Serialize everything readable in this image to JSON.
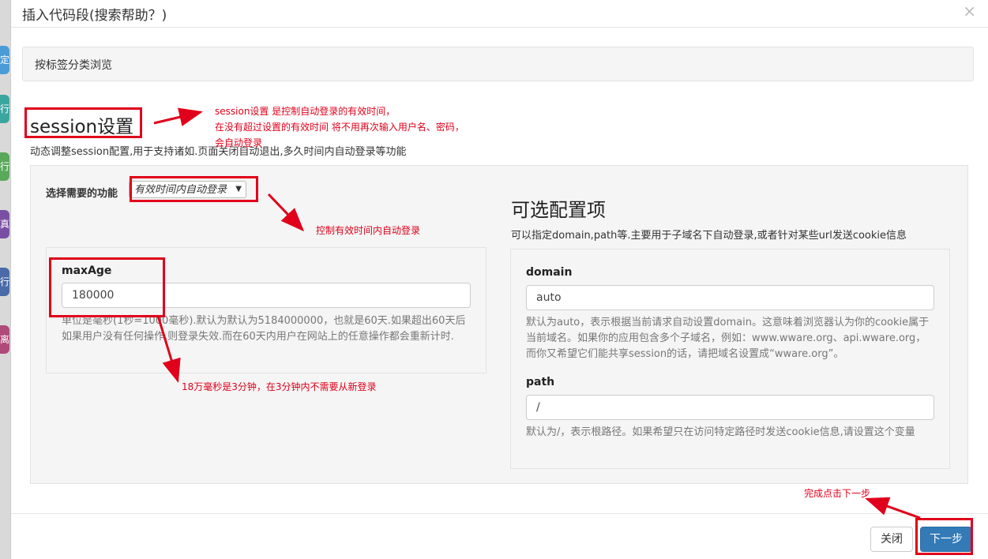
{
  "background": {
    "tabs": [
      {
        "text": "定",
        "color": "#4a9bd6"
      },
      {
        "text": "行",
        "color": "#3aa6a0"
      },
      {
        "text": "行",
        "color": "#5aa85a"
      },
      {
        "text": "真",
        "color": "#7a4fa3"
      },
      {
        "text": "行",
        "color": "#4a6ba8"
      },
      {
        "text": "离",
        "color": "#b04a7a"
      }
    ]
  },
  "modal": {
    "title": "插入代码段(搜索帮助？)",
    "close_glyph": "×"
  },
  "tag_bar": {
    "label": "按标签分类浏览"
  },
  "session": {
    "title": "session设置",
    "description": "动态调整session配置,用于支持诸如.页面关闭自动退出,多久时间内自动登录等功能"
  },
  "function_select": {
    "label": "选择需要的功能",
    "value": "有效时间内自动登录",
    "caret": "▼"
  },
  "maxage": {
    "label": "maxAge",
    "value": "180000",
    "help": "单位是毫秒(1秒=1000毫秒).默认为默认为5184000000，也就是60天.如果超出60天后如果用户没有任何操作,则登录失效.而在60天内用户在网站上的任意操作都会重新计时."
  },
  "optional": {
    "title": "可选配置项",
    "description": "可以指定domain,path等.主要用于子域名下自动登录,或者针对某些url发送cookie信息",
    "domain": {
      "label": "domain",
      "value": "auto",
      "help": "默认为auto，表示根据当前请求自动设置domain。这意味着浏览器认为你的cookie属于当前域名。如果你的应用包含多个子域名，例如：www.wware.org、api.wware.org，而你又希望它们能共享session的话，请把域名设置成“wware.org”。"
    },
    "path": {
      "label": "path",
      "value": "/",
      "help": "默认为/，表示根路径。如果希望只在访问特定路径时发送cookie信息,请设置这个变量"
    }
  },
  "annotations": {
    "session_note": [
      "session设置 是控制自动登录的有效时间，",
      "在没有超过设置的有效时间 将不用再次输入用户名、密码，",
      "会自动登录"
    ],
    "select_note": "控制有效时间内自动登录",
    "maxage_note": "18万毫秒是3分钟，在3分钟内不需要从新登录",
    "next_note": "完成点击下一步",
    "annotation_color": "#e0001b"
  },
  "footer": {
    "close_label": "关闭",
    "next_label": "下一步",
    "primary_color": "#337ab7"
  }
}
